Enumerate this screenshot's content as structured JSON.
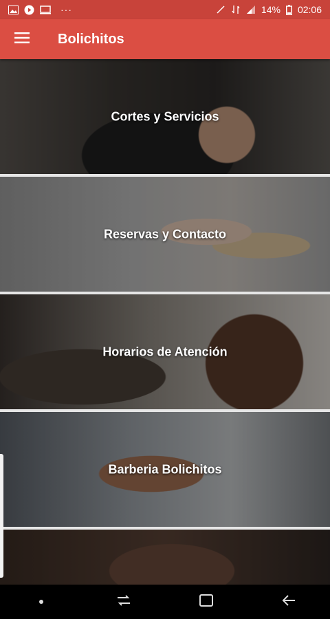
{
  "status_bar": {
    "battery": "14%",
    "time": "02:06",
    "icons": [
      "image-icon",
      "play-icon",
      "screen-icon",
      "more-dots-icon",
      "mute-icon",
      "data-4g-icon",
      "signal-icon",
      "battery-icon"
    ],
    "overflow": "···"
  },
  "app_bar": {
    "title": "Bolichitos",
    "menu_icon": "hamburger-menu-icon"
  },
  "cards": [
    {
      "title": "Cortes y Servicios"
    },
    {
      "title": "Reservas y Contacto"
    },
    {
      "title": "Horarios de Atención"
    },
    {
      "title": "Barberia Bolichitos"
    },
    {
      "title": ""
    }
  ],
  "nav_bar": {
    "icons": [
      "dot-icon",
      "recents-icon",
      "home-icon",
      "back-icon"
    ]
  },
  "colors": {
    "status_bar": "#c8433a",
    "app_bar": "#db4e43",
    "divider": "#e6e6e6"
  }
}
